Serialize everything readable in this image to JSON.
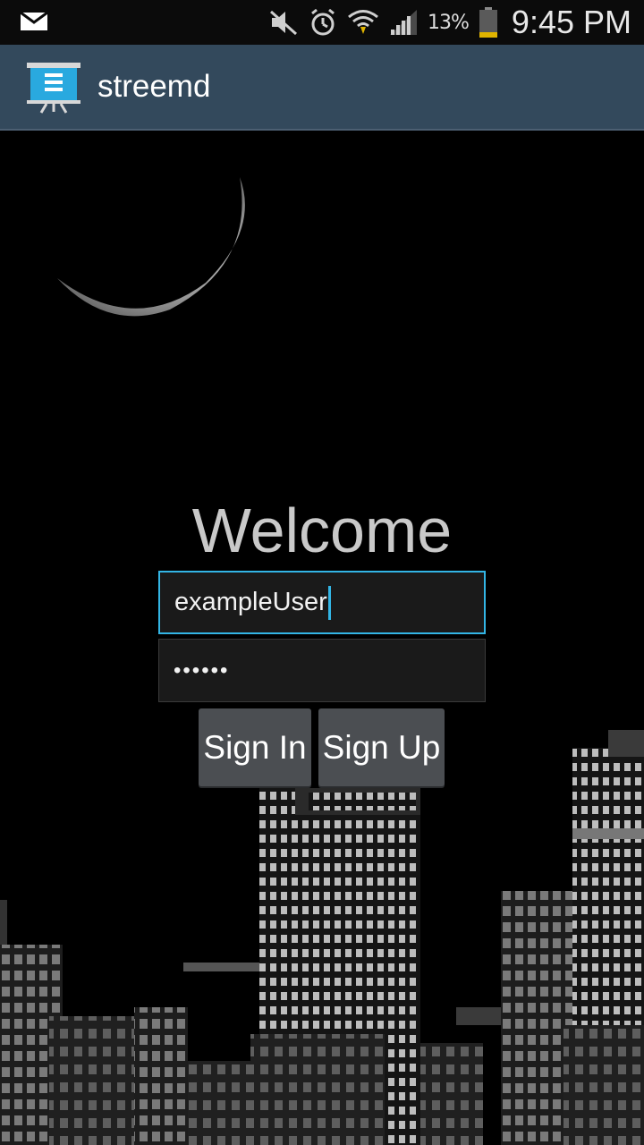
{
  "status_bar": {
    "battery_percent": "13%",
    "time": "9:45 PM",
    "icons": [
      "mail-icon",
      "mute-icon",
      "alarm-icon",
      "wifi-icon",
      "signal-icon",
      "battery-icon"
    ]
  },
  "action_bar": {
    "title": "streemd",
    "icon": "presentation-board-icon"
  },
  "login": {
    "heading": "Welcome",
    "username_value": "exampleUser",
    "password_value": "••••••",
    "sign_in_label": "Sign In",
    "sign_up_label": "Sign Up"
  },
  "colors": {
    "action_bar": "#33495c",
    "focus_accent": "#33b5e5",
    "button": "#4b4e52"
  }
}
